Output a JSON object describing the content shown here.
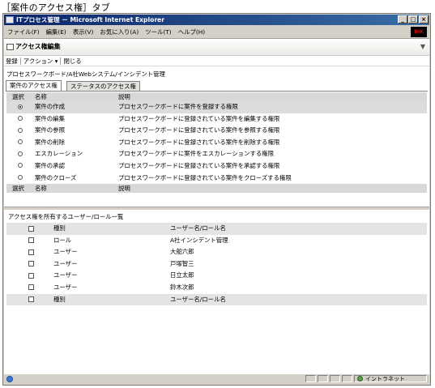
{
  "caption": "［案件のアクセス権］タブ",
  "window": {
    "title": "ITプロセス管理 － Microsoft Internet Explorer",
    "buttons": [
      "_",
      "□",
      "×"
    ],
    "brand": "BIK"
  },
  "menu": [
    "ファイル(F)",
    "編集(E)",
    "表示(V)",
    "お気に入り(A)",
    "ツール(T)",
    "ヘルプ(H)"
  ],
  "pane": {
    "title": "アクセス権編集",
    "toolbar": {
      "register": "登録",
      "action": "アクション ▾",
      "close": "閉じる"
    },
    "breadcrumb": "プロセスワークボード/A社Webシステム/インシデント管理"
  },
  "tabs": [
    "案件のアクセス権",
    "ステータスのアクセス権"
  ],
  "permissions": {
    "headers": [
      "選択",
      "名称",
      "説明"
    ],
    "rows": [
      {
        "name": "案件の作成",
        "desc": "プロセスワークボードに案件を登録する権限",
        "checked": true
      },
      {
        "name": "案件の編集",
        "desc": "プロセスワークボードに登録されている案件を編集する権限",
        "checked": false
      },
      {
        "name": "案件の参照",
        "desc": "プロセスワークボードに登録されている案件を参照する権限",
        "checked": false
      },
      {
        "name": "案件の削除",
        "desc": "プロセスワークボードに登録されている案件を削除する権限",
        "checked": false
      },
      {
        "name": "エスカレーション",
        "desc": "プロセスワークボードに案件をエスカレーションする権限",
        "checked": false
      },
      {
        "name": "案件の承認",
        "desc": "プロセスワークボードに登録されている案件を承認する権限",
        "checked": false
      },
      {
        "name": "案件のクローズ",
        "desc": "プロセスワークボードに登録されている案件をクローズする権限",
        "checked": false
      }
    ],
    "footer": [
      "選択",
      "名称",
      "説明"
    ]
  },
  "users": {
    "title": "アクセス権を所有するユーザー/ロール一覧",
    "headers": [
      "種別",
      "ユーザー名/ロール名"
    ],
    "rows": [
      {
        "type": "ロール",
        "name": "A社インシデント管理"
      },
      {
        "type": "ユーザー",
        "name": "大船六郎"
      },
      {
        "type": "ユーザー",
        "name": "戸塚智三"
      },
      {
        "type": "ユーザー",
        "name": "日立太郎"
      },
      {
        "type": "ユーザー",
        "name": "鈴木次郎"
      }
    ],
    "footer": [
      "種別",
      "ユーザー名/ロール名"
    ]
  },
  "status": {
    "zone": "イントラネット"
  }
}
